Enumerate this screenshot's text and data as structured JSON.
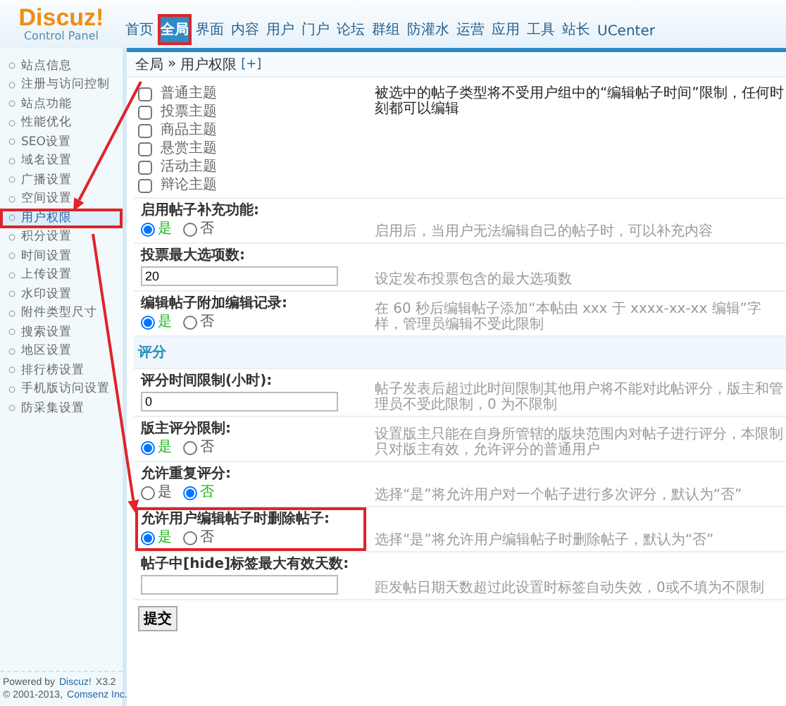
{
  "logo": {
    "title": "Discuz!",
    "subtitle": "Control Panel"
  },
  "nav": [
    {
      "label": "首页",
      "selected": false,
      "highlighted": false
    },
    {
      "label": "全局",
      "selected": true,
      "highlighted": true
    },
    {
      "label": "界面",
      "selected": false,
      "highlighted": false
    },
    {
      "label": "内容",
      "selected": false,
      "highlighted": false
    },
    {
      "label": "用户",
      "selected": false,
      "highlighted": false
    },
    {
      "label": "门户",
      "selected": false,
      "highlighted": false
    },
    {
      "label": "论坛",
      "selected": false,
      "highlighted": false
    },
    {
      "label": "群组",
      "selected": false,
      "highlighted": false
    },
    {
      "label": "防灌水",
      "selected": false,
      "highlighted": false
    },
    {
      "label": "运营",
      "selected": false,
      "highlighted": false
    },
    {
      "label": "应用",
      "selected": false,
      "highlighted": false
    },
    {
      "label": "工具",
      "selected": false,
      "highlighted": false
    },
    {
      "label": "站长",
      "selected": false,
      "highlighted": false
    },
    {
      "label": "UCenter",
      "selected": false,
      "highlighted": false
    }
  ],
  "breadcrumb": {
    "parent": "全局",
    "separator": "»",
    "current": "用户权限",
    "add": "[+]"
  },
  "sidebar": {
    "items": [
      {
        "label": "站点信息",
        "selected": false,
        "highlighted": false
      },
      {
        "label": "注册与访问控制",
        "selected": false,
        "highlighted": false
      },
      {
        "label": "站点功能",
        "selected": false,
        "highlighted": false
      },
      {
        "label": "性能优化",
        "selected": false,
        "highlighted": false
      },
      {
        "label": "SEO设置",
        "selected": false,
        "highlighted": false
      },
      {
        "label": "域名设置",
        "selected": false,
        "highlighted": false
      },
      {
        "label": "广播设置",
        "selected": false,
        "highlighted": false
      },
      {
        "label": "空间设置",
        "selected": false,
        "highlighted": false
      },
      {
        "label": "用户权限",
        "selected": true,
        "highlighted": true
      },
      {
        "label": "积分设置",
        "selected": false,
        "highlighted": false
      },
      {
        "label": "时间设置",
        "selected": false,
        "highlighted": false
      },
      {
        "label": "上传设置",
        "selected": false,
        "highlighted": false
      },
      {
        "label": "水印设置",
        "selected": false,
        "highlighted": false
      },
      {
        "label": "附件类型尺寸",
        "selected": false,
        "highlighted": false
      },
      {
        "label": "搜索设置",
        "selected": false,
        "highlighted": false
      },
      {
        "label": "地区设置",
        "selected": false,
        "highlighted": false
      },
      {
        "label": "排行榜设置",
        "selected": false,
        "highlighted": false
      },
      {
        "label": "手机版访问设置",
        "selected": false,
        "highlighted": false
      },
      {
        "label": "防采集设置",
        "selected": false,
        "highlighted": false
      }
    ],
    "footer": {
      "powered": "Powered by",
      "product": "Discuz!",
      "version": "X3.2",
      "copyright": "© 2001-2013,",
      "company": "Comsenz Inc."
    }
  },
  "settings": [
    {
      "kind": "checkboxes",
      "items": [
        {
          "label": "普通主题",
          "checked": false
        },
        {
          "label": "投票主题",
          "checked": false
        },
        {
          "label": "商品主题",
          "checked": false
        },
        {
          "label": "悬赏主题",
          "checked": false
        },
        {
          "label": "活动主题",
          "checked": false
        },
        {
          "label": "辩论主题",
          "checked": false
        }
      ],
      "description": "被选中的帖子类型将不受用户组中的“编辑帖子时间”限制，任何时刻都可以编辑"
    },
    {
      "kind": "radio",
      "title": "启用帖子补充功能:",
      "highlighted": false,
      "options": [
        {
          "label": "是",
          "selected": true
        },
        {
          "label": "否",
          "selected": false
        }
      ],
      "description": "启用后，当用户无法编辑自己的帖子时，可以补充内容"
    },
    {
      "kind": "text",
      "title": "投票最大选项数:",
      "value": "20",
      "description": "设定发布投票包含的最大选项数"
    },
    {
      "kind": "radio",
      "title": "编辑帖子附加编辑记录:",
      "highlighted": false,
      "options": [
        {
          "label": "是",
          "selected": true
        },
        {
          "label": "否",
          "selected": false
        }
      ],
      "description": "在 60 秒后编辑帖子添加“本帖由 xxx 于 xxxx-xx-xx 编辑”字样，管理员编辑不受此限制"
    },
    {
      "kind": "section",
      "title": "评分"
    },
    {
      "kind": "text",
      "title": "评分时间限制(小时):",
      "value": "0",
      "description": "帖子发表后超过此时间限制其他用户将不能对此帖评分，版主和管理员不受此限制，0 为不限制"
    },
    {
      "kind": "radio",
      "title": "版主评分限制:",
      "highlighted": false,
      "options": [
        {
          "label": "是",
          "selected": true
        },
        {
          "label": "否",
          "selected": false
        }
      ],
      "description": "设置版主只能在自身所管辖的版块范围内对帖子进行评分，本限制只对版主有效，允许评分的普通用户"
    },
    {
      "kind": "radio",
      "title": "允许重复评分:",
      "highlighted": false,
      "options": [
        {
          "label": "是",
          "selected": false
        },
        {
          "label": "否",
          "selected": true
        }
      ],
      "description": "选择“是”将允许用户对一个帖子进行多次评分，默认为“否”"
    },
    {
      "kind": "radio",
      "title": "允许用户编辑帖子时删除帖子:",
      "highlighted": true,
      "options": [
        {
          "label": "是",
          "selected": true
        },
        {
          "label": "否",
          "selected": false
        }
      ],
      "description": "选择“是”将允许用户编辑帖子时删除帖子，默认为“否”"
    },
    {
      "kind": "text",
      "title": "帖子中[hide]标签最大有效天数:",
      "description": "距发帖日期天数超过此设置时标签自动失效，0或不填为不限制"
    },
    {
      "kind": "submit",
      "label": "提交"
    }
  ]
}
